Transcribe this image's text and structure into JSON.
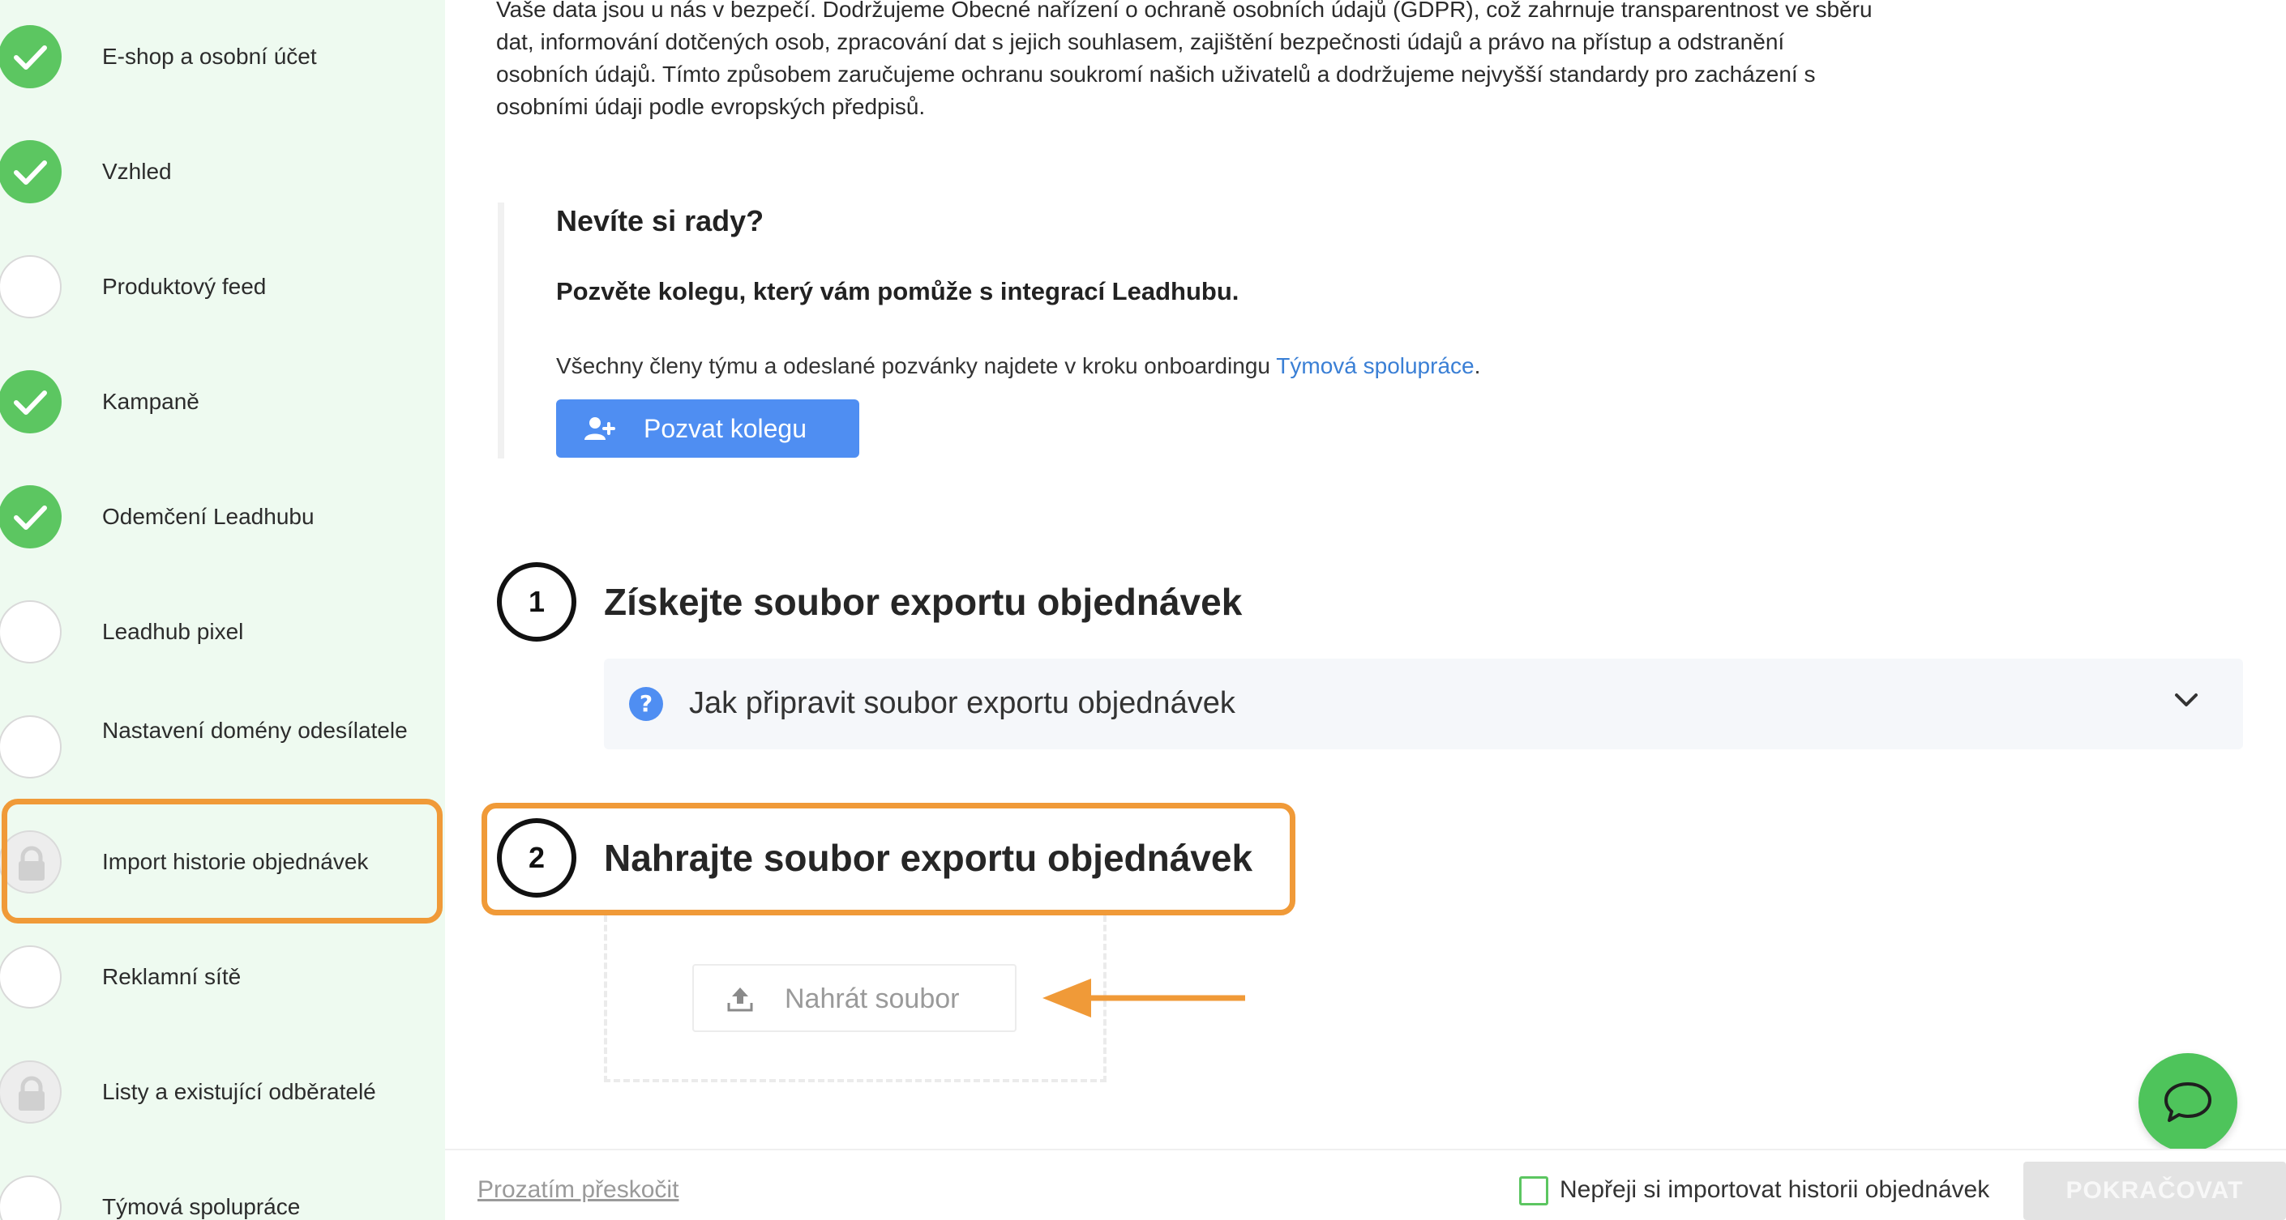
{
  "sidebar": {
    "items": [
      {
        "label": "E-shop a osobní účet",
        "status": "done"
      },
      {
        "label": "Vzhled",
        "status": "done"
      },
      {
        "label": "Produktový feed",
        "status": "todo"
      },
      {
        "label": "Kampaně",
        "status": "done"
      },
      {
        "label": "Odemčení Leadhubu",
        "status": "done"
      },
      {
        "label": "Leadhub pixel",
        "status": "todo"
      },
      {
        "label": "Nastavení domény odesílatele",
        "status": "todo"
      },
      {
        "label": "Import historie objednávek",
        "status": "locked",
        "active": true
      },
      {
        "label": "Reklamní sítě",
        "status": "todo"
      },
      {
        "label": "Listy a existující odběratelé",
        "status": "locked"
      },
      {
        "label": "Týmová spolupráce",
        "status": "todo"
      }
    ]
  },
  "main": {
    "gdpr_text": "Vaše data jsou u nás v bezpečí. Dodržujeme Obecné nařízení o ochraně osobních údajů (GDPR), což zahrnuje transparentnost ve sběru dat, informování dotčených osob, zpracování dat s jejich souhlasem, zajištění bezpečnosti údajů a právo na přístup a odstranění osobních údajů. Tímto způsobem zaručujeme ochranu soukromí našich uživatelů a dodržujeme nejvyšší standardy pro zacházení s osobními údaji podle evropských předpisů.",
    "help": {
      "title": "Nevíte si rady?",
      "subtitle": "Pozvěte kolegu, který vám pomůže s integrací Leadhubu.",
      "note_prefix": "Všechny členy týmu a odeslané pozvánky najdete v kroku onboardingu ",
      "note_link": "Týmová spolupráce",
      "note_suffix": ".",
      "invite_button": "Pozvat kolegu"
    },
    "step1": {
      "number": "1",
      "title": "Získejte soubor exportu objednávek",
      "accordion_label": "Jak připravit soubor exportu objednávek"
    },
    "step2": {
      "number": "2",
      "title": "Nahrajte soubor exportu objednávek",
      "upload_button": "Nahrát soubor"
    }
  },
  "footer": {
    "skip_link": "Prozatím přeskočit",
    "checkbox_label": "Nepřeji si importovat historii objednávek",
    "continue_button": "POKRAČOVAT"
  },
  "colors": {
    "sidebar_bg": "#eefaf0",
    "done_green": "#5cc661",
    "highlight_orange": "#f09a38",
    "primary_blue": "#4f8ef2",
    "link_blue": "#3a7fd5"
  },
  "icons": {
    "done": "check-icon",
    "locked": "lock-icon",
    "invite": "user-plus-icon",
    "help": "question-circle-icon",
    "accordion": "chevron-down-icon",
    "upload": "upload-icon",
    "chat": "chat-bubble-icon"
  }
}
